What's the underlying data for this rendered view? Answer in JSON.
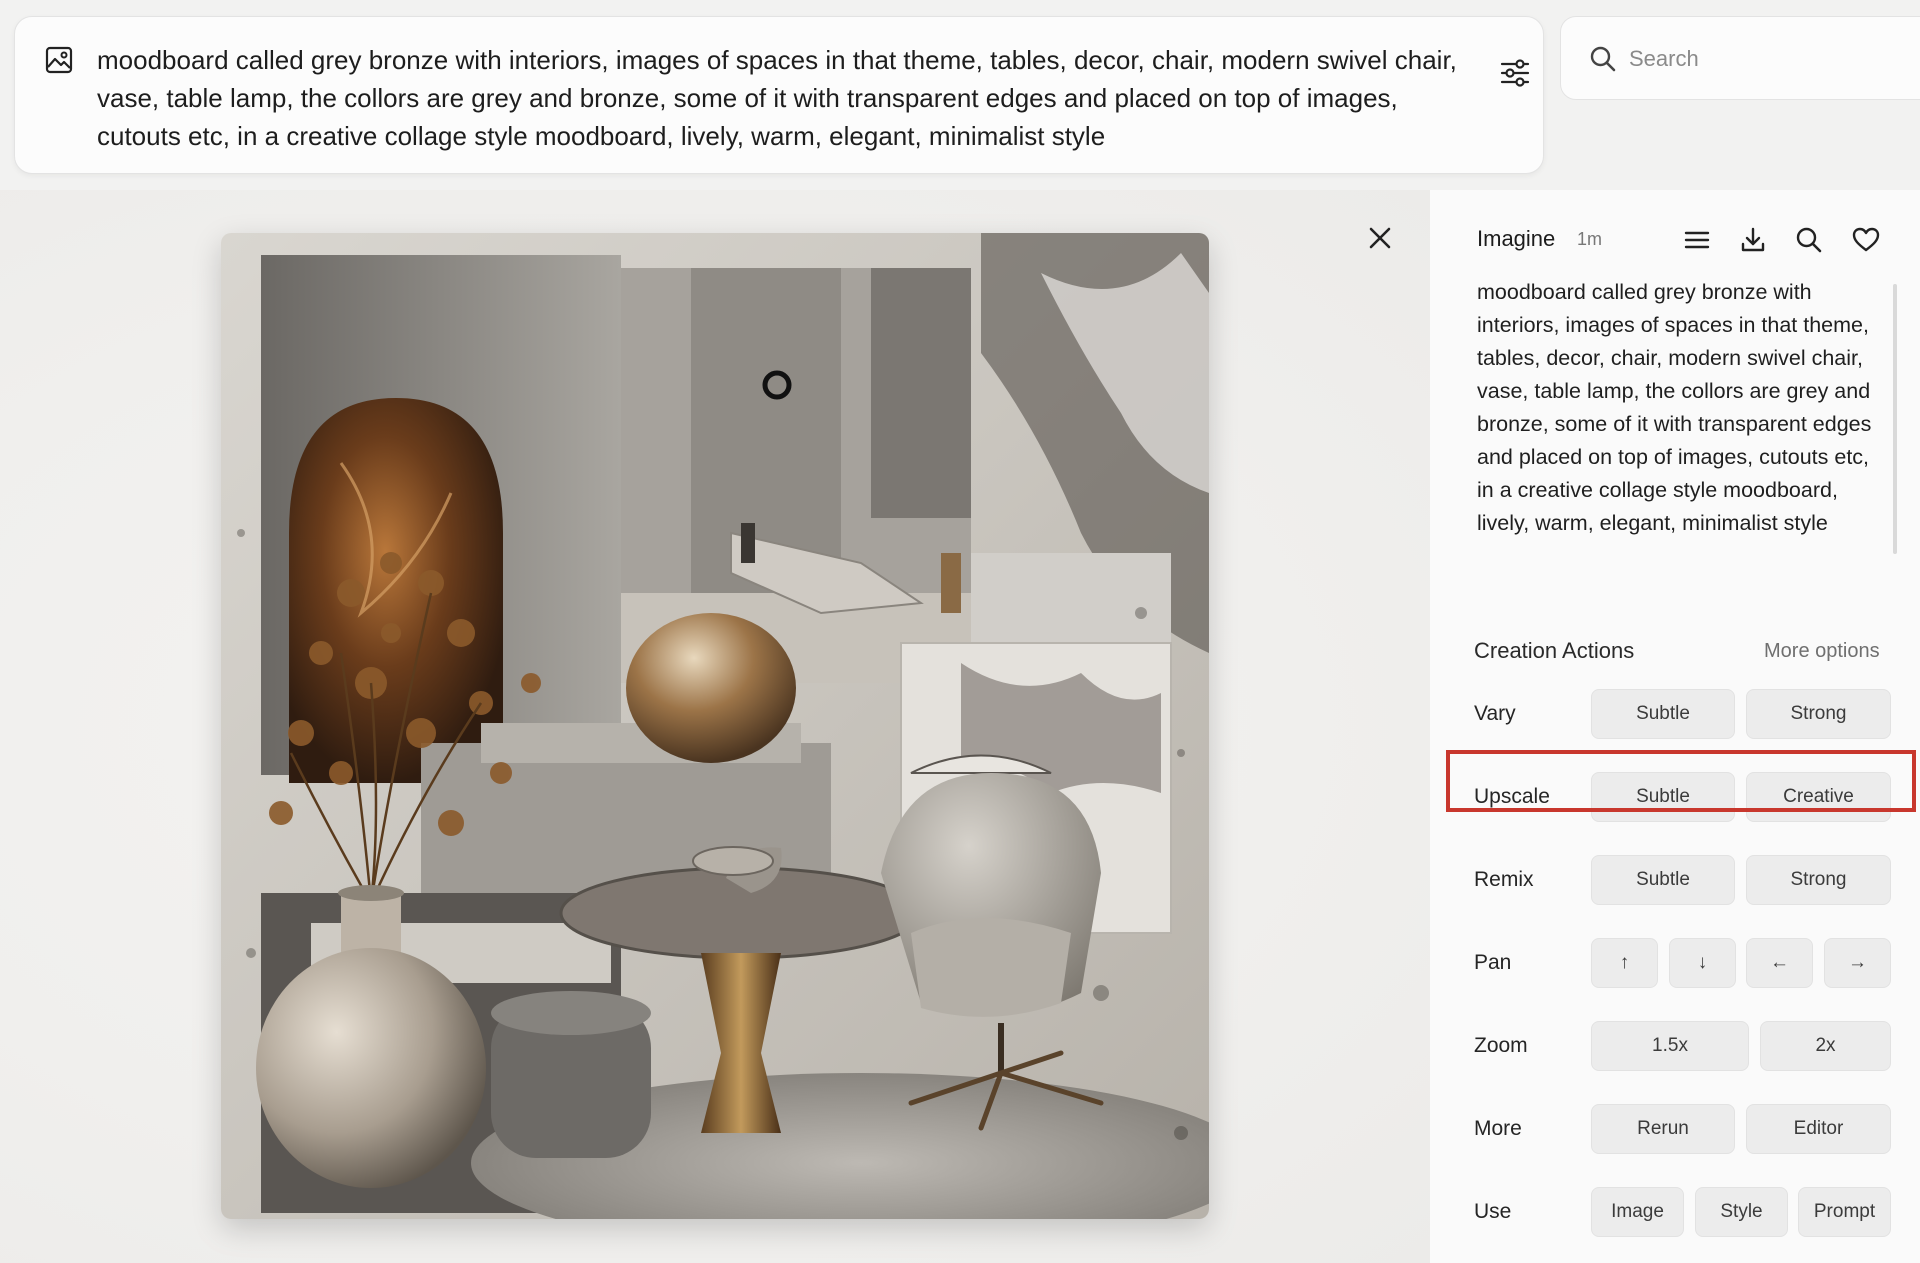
{
  "prompt": {
    "text": "moodboard called grey bronze with interiors, images of spaces in that theme, tables, decor, chair, modern swivel chair, vase, table lamp, the collors are grey and bronze, some of it with transparent edges and placed on top of images, cutouts etc, in a creative collage style moodboard, lively, warm, elegant, minimalist style",
    "icon": "image-icon",
    "settings_icon": "sliders-icon"
  },
  "search": {
    "placeholder": "Search"
  },
  "detail": {
    "title": "Imagine",
    "time": "1m",
    "icons": [
      "list-icon",
      "download-icon",
      "search-icon",
      "heart-icon"
    ],
    "description": "moodboard called grey bronze with interiors, images of spaces in that theme, tables, decor, chair, modern swivel chair, vase, table lamp, the collors are grey and bronze, some of it with transparent edges and placed on top of images, cutouts etc, in a creative collage style moodboard, lively, warm, elegant, minimalist style"
  },
  "creation_actions": {
    "title": "Creation Actions",
    "more_options": "More options",
    "vary": {
      "label": "Vary",
      "buttons": [
        "Subtle",
        "Strong"
      ]
    },
    "upscale": {
      "label": "Upscale",
      "buttons": [
        "Subtle",
        "Creative"
      ]
    },
    "remix": {
      "label": "Remix",
      "buttons": [
        "Subtle",
        "Strong"
      ]
    },
    "pan": {
      "label": "Pan",
      "buttons": [
        "↑",
        "↓",
        "←",
        "→"
      ]
    },
    "zoom": {
      "label": "Zoom",
      "buttons": [
        "1.5x",
        "2x"
      ]
    },
    "more": {
      "label": "More",
      "buttons": [
        "Rerun",
        "Editor"
      ]
    },
    "use": {
      "label": "Use",
      "buttons": [
        "Image",
        "Style",
        "Prompt"
      ]
    }
  },
  "colors": {
    "highlight": "#c8372d",
    "bronze": "#8a5a2b",
    "grey": "#8d8a86"
  }
}
